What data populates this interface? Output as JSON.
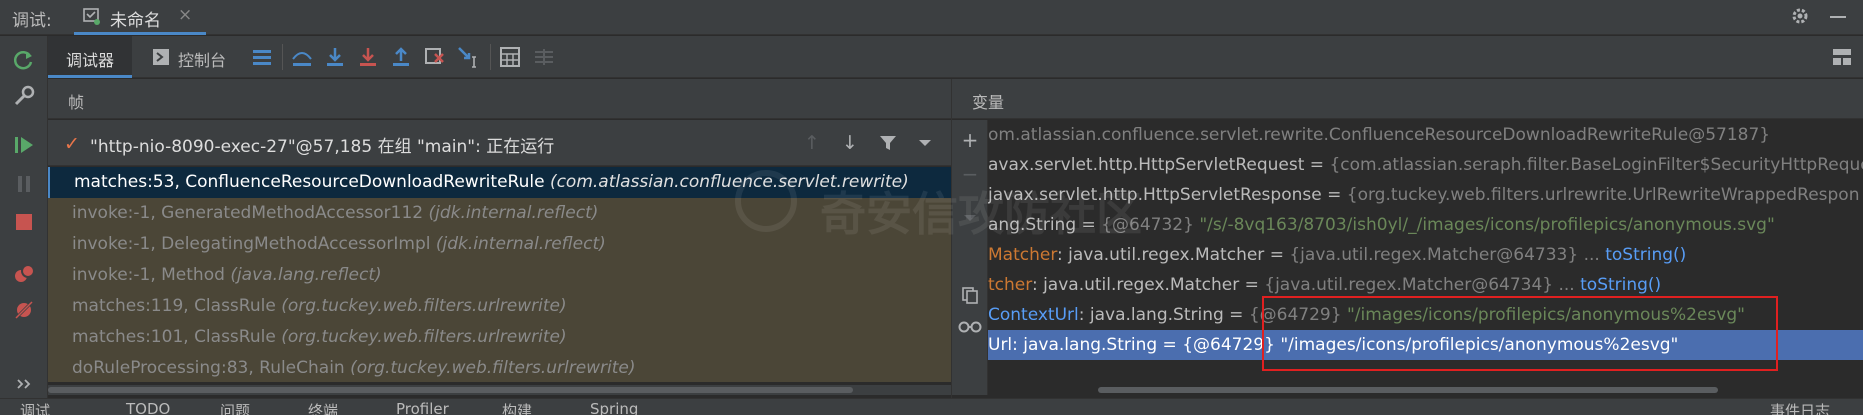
{
  "topbar": {
    "debug_label": "调试:",
    "tab_title": "未命名",
    "tab_close": "×"
  },
  "toolbar": {
    "tab_debugger": "调试器",
    "tab_console": "控制台"
  },
  "frames": {
    "header": "帧",
    "thread": {
      "check": "✓",
      "text": "\"http-nio-8090-exec-27\"@57,185 在组 \"main\": 正在运行"
    },
    "items": [
      {
        "method": "matches:53, ConfluenceResourceDownloadRewriteRule",
        "pkg": "(com.atlassian.confluence.servlet.rewrite)"
      },
      {
        "method": "invoke:-1, GeneratedMethodAccessor112",
        "pkg": "(jdk.internal.reflect)"
      },
      {
        "method": "invoke:-1, DelegatingMethodAccessorImpl",
        "pkg": "(jdk.internal.reflect)"
      },
      {
        "method": "invoke:-1, Method",
        "pkg": "(java.lang.reflect)"
      },
      {
        "method": "matches:119, ClassRule",
        "pkg": "(org.tuckey.web.filters.urlrewrite)"
      },
      {
        "method": "matches:101, ClassRule",
        "pkg": "(org.tuckey.web.filters.urlrewrite)"
      },
      {
        "method": "doRuleProcessing:83, RuleChain",
        "pkg": "(org.tuckey.web.filters.urlrewrite)"
      }
    ]
  },
  "variables": {
    "header": "变量",
    "items": [
      {
        "name": "",
        "type": "",
        "eq": "",
        "ref": "",
        "val": "om.atlassian.confluence.servlet.rewrite.ConfluenceResourceDownloadRewriteRule@57187}",
        "link": ""
      },
      {
        "name": "",
        "type": "avax.servlet.http.HttpServletRequest",
        "eq": " = ",
        "ref": "{com.atlassian.seraph.filter.BaseLoginFilter$SecurityHttpReque",
        "val": "",
        "link": ""
      },
      {
        "name": "",
        "type": "javax.servlet.http.HttpServletResponse",
        "eq": " = ",
        "ref": "{org.tuckey.web.filters.urlrewrite.UrlRewriteWrappedRespon",
        "val": "",
        "link": ""
      },
      {
        "name": "",
        "type": "ang.String",
        "eq": " = ",
        "ref": "{@64732} ",
        "val": "\"/s/-8vq163/8703/ish0yl/_/images/icons/profilepics/anonymous.svg\"",
        "link": ""
      },
      {
        "name": "Matcher",
        "type": ": java.util.regex.Matcher",
        "eq": " = ",
        "ref": "{java.util.regex.Matcher@64733} ... ",
        "val": "",
        "link": "toString()"
      },
      {
        "name": "tcher",
        "type": ": java.util.regex.Matcher",
        "eq": " = ",
        "ref": "{java.util.regex.Matcher@64734} ... ",
        "val": "",
        "link": "toString()"
      },
      {
        "name": "ContextUrl",
        "type": ": java.lang.String",
        "eq": " = ",
        "ref": "{@64729} ",
        "val": "\"/images/icons/profilepics/anonymous%2esvg\"",
        "link": ""
      },
      {
        "name": "Url",
        "type": ": java.lang.String",
        "eq": " = ",
        "ref": "{@64729} ",
        "val": "\"/images/icons/profilepics/anonymous%2esvg\"",
        "link": ""
      }
    ]
  },
  "watermark": "奇安信攻防社区",
  "bottombar": {
    "items": [
      "调试",
      "TODO",
      "问题",
      "终端",
      "Profiler",
      "构建",
      "Spring"
    ],
    "right": "事件日志"
  },
  "colors": {
    "accent": "#4a88c7",
    "selection": "#4b6eaf",
    "highlight_box": "#e02020",
    "string_value": "#6a8759",
    "field_name": "#cc7832"
  }
}
